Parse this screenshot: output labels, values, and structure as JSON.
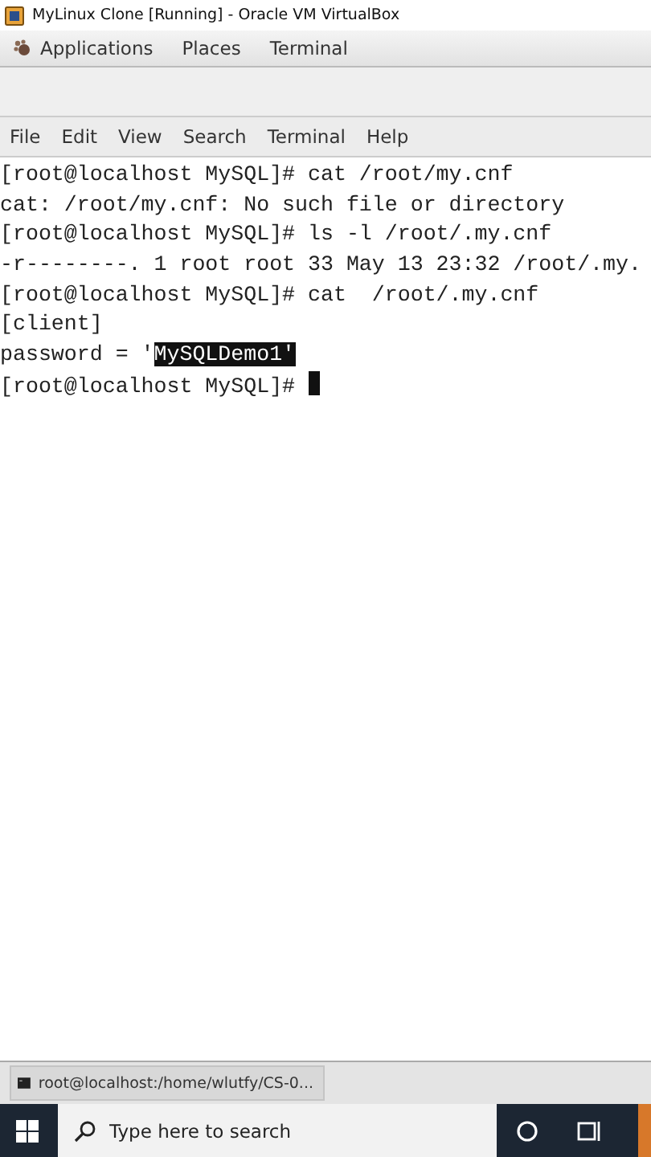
{
  "window": {
    "title": "MyLinux Clone [Running] - Oracle VM VirtualBox"
  },
  "top_bar": {
    "items": [
      "Applications",
      "Places",
      "Terminal"
    ]
  },
  "menu_bar": [
    "File",
    "Edit",
    "View",
    "Search",
    "Terminal",
    "Help"
  ],
  "terminal": {
    "lines": [
      {
        "segments": [
          {
            "text": "[root@localhost MySQL]# cat /root/my.cnf",
            "selected": false
          }
        ],
        "cursor": false
      },
      {
        "segments": [
          {
            "text": "cat: /root/my.cnf: No such file or directory",
            "selected": false
          }
        ],
        "cursor": false
      },
      {
        "segments": [
          {
            "text": "[root@localhost MySQL]# ls -l /root/.my.cnf",
            "selected": false
          }
        ],
        "cursor": false
      },
      {
        "segments": [
          {
            "text": "-r--------. 1 root root 33 May 13 23:32 /root/.my.",
            "selected": false
          }
        ],
        "cursor": false
      },
      {
        "segments": [
          {
            "text": "[root@localhost MySQL]# cat  /root/.my.cnf",
            "selected": false
          }
        ],
        "cursor": false
      },
      {
        "segments": [
          {
            "text": "[client]",
            "selected": false
          }
        ],
        "cursor": false
      },
      {
        "segments": [
          {
            "text": "password = '",
            "selected": false
          },
          {
            "text": "MySQLDemo1'",
            "selected": true
          }
        ],
        "cursor": false
      },
      {
        "segments": [
          {
            "text": "[root@localhost MySQL]# ",
            "selected": false
          }
        ],
        "cursor": true
      }
    ]
  },
  "window_list": [
    {
      "label": "root@localhost:/home/wlutfy/CS-0..."
    }
  ],
  "taskbar": {
    "search": {
      "placeholder": "Type here to search"
    }
  }
}
